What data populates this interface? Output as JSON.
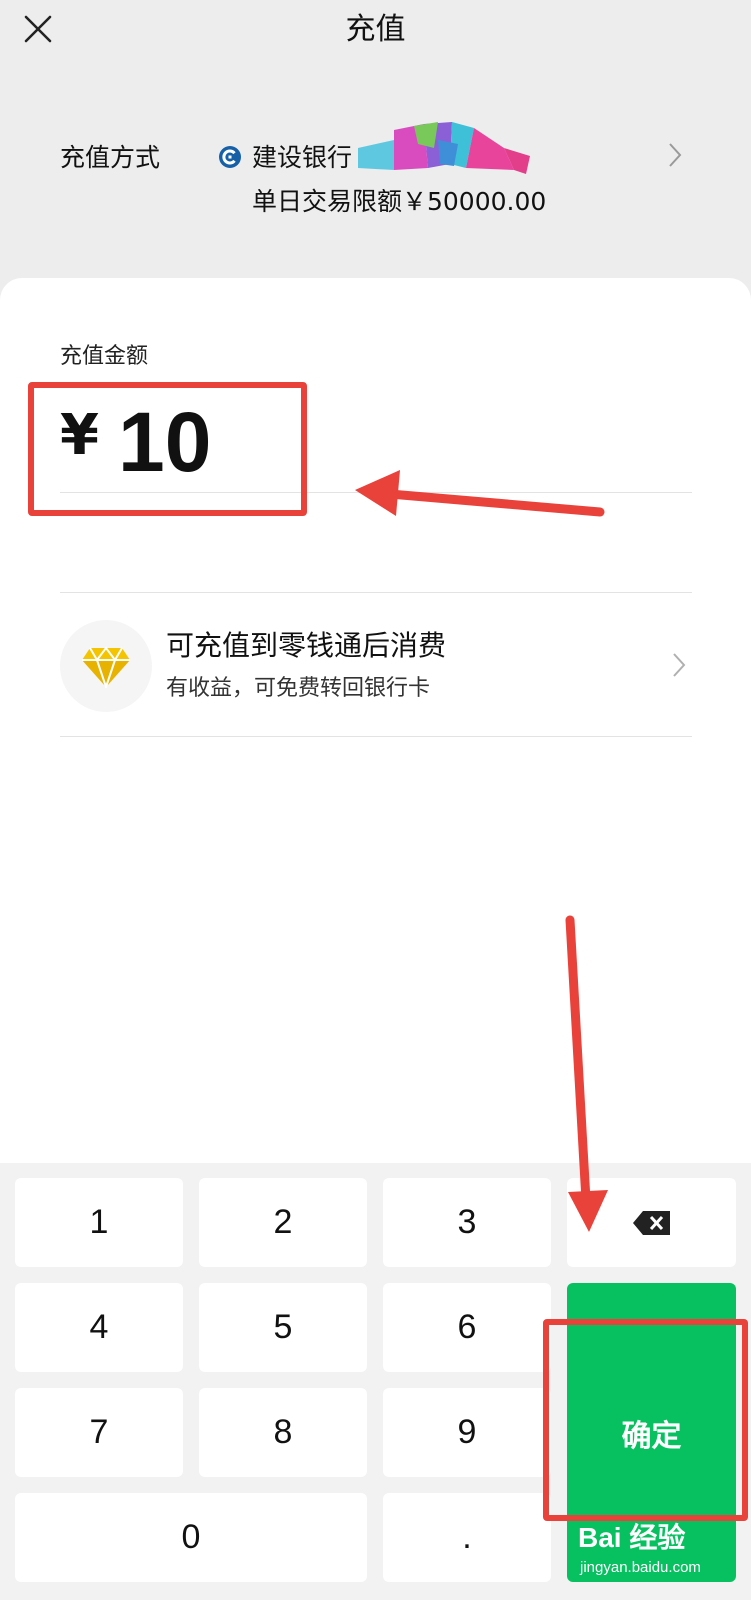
{
  "header": {
    "title": "充值",
    "close_icon": "close-icon"
  },
  "payment_method": {
    "label": "充值方式",
    "bank_icon": "ccb-bank-logo-icon",
    "bank_name": "建设银行",
    "limit_text": "单日交易限额￥50000.00",
    "chevron_icon": "chevron-right-icon"
  },
  "amount": {
    "label": "充值金额",
    "currency": "¥",
    "value": "10"
  },
  "promo": {
    "icon": "diamond-icon",
    "title": "可充值到零钱通后消费",
    "subtitle": "有收益，可免费转回银行卡",
    "chevron_icon": "chevron-right-icon"
  },
  "keypad": {
    "keys": [
      "1",
      "2",
      "3",
      "4",
      "5",
      "6",
      "7",
      "8",
      "9",
      "0",
      "."
    ],
    "backspace_icon": "backspace-icon",
    "confirm_label": "确定"
  },
  "colors": {
    "accent_green": "#07c160",
    "annotation_red": "#e8423a",
    "bank_blue": "#1660a8",
    "diamond_yellow": "#f5c400"
  },
  "watermark": {
    "main": "Bai 经验",
    "url": "jingyan.baidu.com"
  }
}
